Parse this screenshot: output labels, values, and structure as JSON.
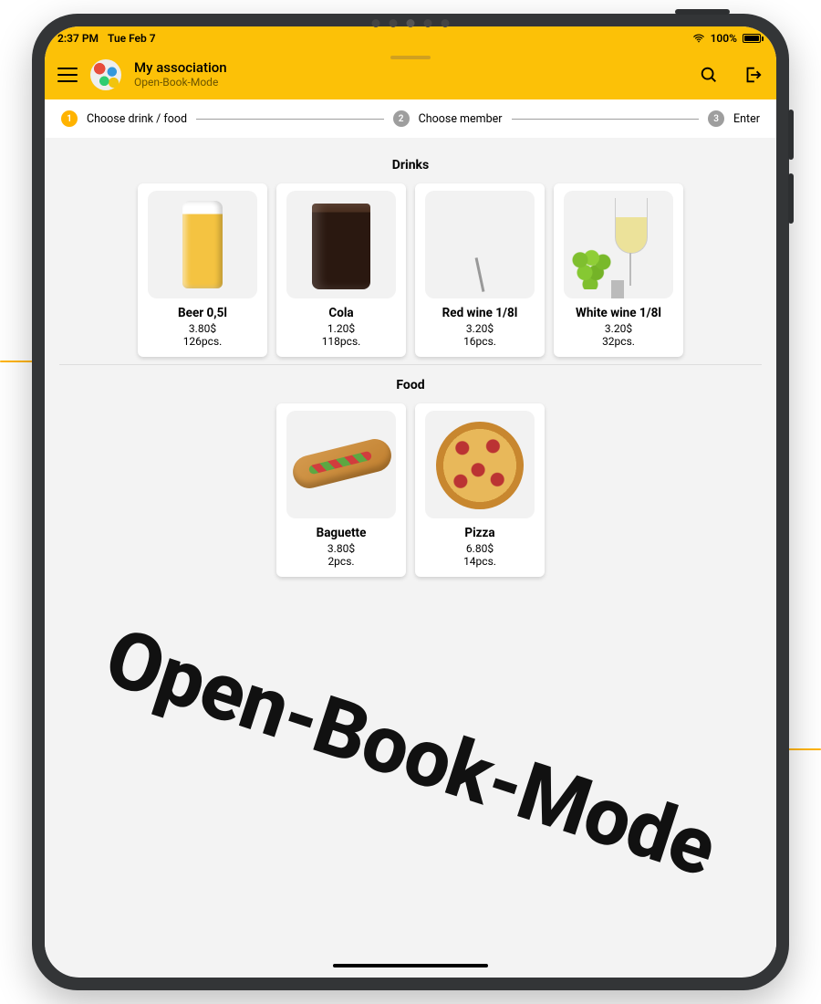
{
  "statusbar": {
    "time": "2:37 PM",
    "date": "Tue Feb 7",
    "battery": "100%"
  },
  "appbar": {
    "title": "My association",
    "subtitle": "Open-Book-Mode"
  },
  "stepper": {
    "step1": {
      "num": "1",
      "label": "Choose drink / food"
    },
    "step2": {
      "num": "2",
      "label": "Choose member"
    },
    "step3": {
      "num": "3",
      "label": "Enter"
    }
  },
  "sections": {
    "drinks": {
      "title": "Drinks",
      "items": [
        {
          "name": "Beer 0,5l",
          "price": "3.80$",
          "stock": "126pcs."
        },
        {
          "name": "Cola",
          "price": "1.20$",
          "stock": "118pcs."
        },
        {
          "name": "Red wine 1/8l",
          "price": "3.20$",
          "stock": "16pcs."
        },
        {
          "name": "White wine 1/8l",
          "price": "3.20$",
          "stock": "32pcs."
        }
      ]
    },
    "food": {
      "title": "Food",
      "items": [
        {
          "name": "Baguette",
          "price": "3.80$",
          "stock": "2pcs."
        },
        {
          "name": "Pizza",
          "price": "6.80$",
          "stock": "14pcs."
        }
      ]
    }
  },
  "watermark": "Open-Book-Mode"
}
